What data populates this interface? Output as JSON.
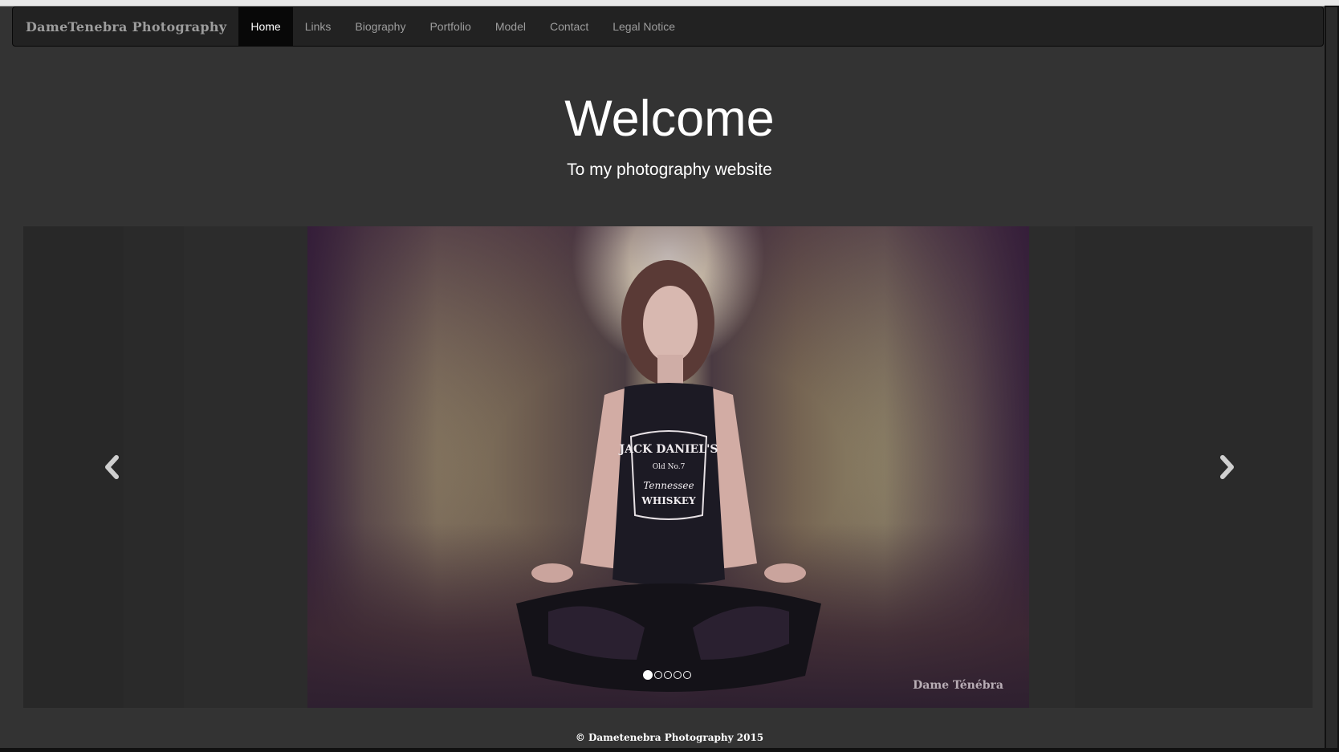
{
  "navbar": {
    "brand": "DameTenebra Photography",
    "items": [
      {
        "label": "Home",
        "active": true
      },
      {
        "label": "Links"
      },
      {
        "label": "Biography"
      },
      {
        "label": "Portfolio"
      },
      {
        "label": "Model"
      },
      {
        "label": "Contact"
      },
      {
        "label": "Legal Notice"
      }
    ]
  },
  "hero": {
    "title": "Welcome",
    "subtitle": "To my photography website"
  },
  "carousel": {
    "slide_count": 5,
    "active_slide": 1,
    "prev_icon": "chevron-left-icon",
    "next_icon": "chevron-right-icon",
    "slide_watermark": "Dame Ténébra",
    "shirt_text": [
      "JACK DANIEL'S",
      "Old No.7",
      "Tennessee",
      "WHISKEY"
    ]
  },
  "footer": {
    "copyright": "© Dametenebra Photography 2015"
  }
}
